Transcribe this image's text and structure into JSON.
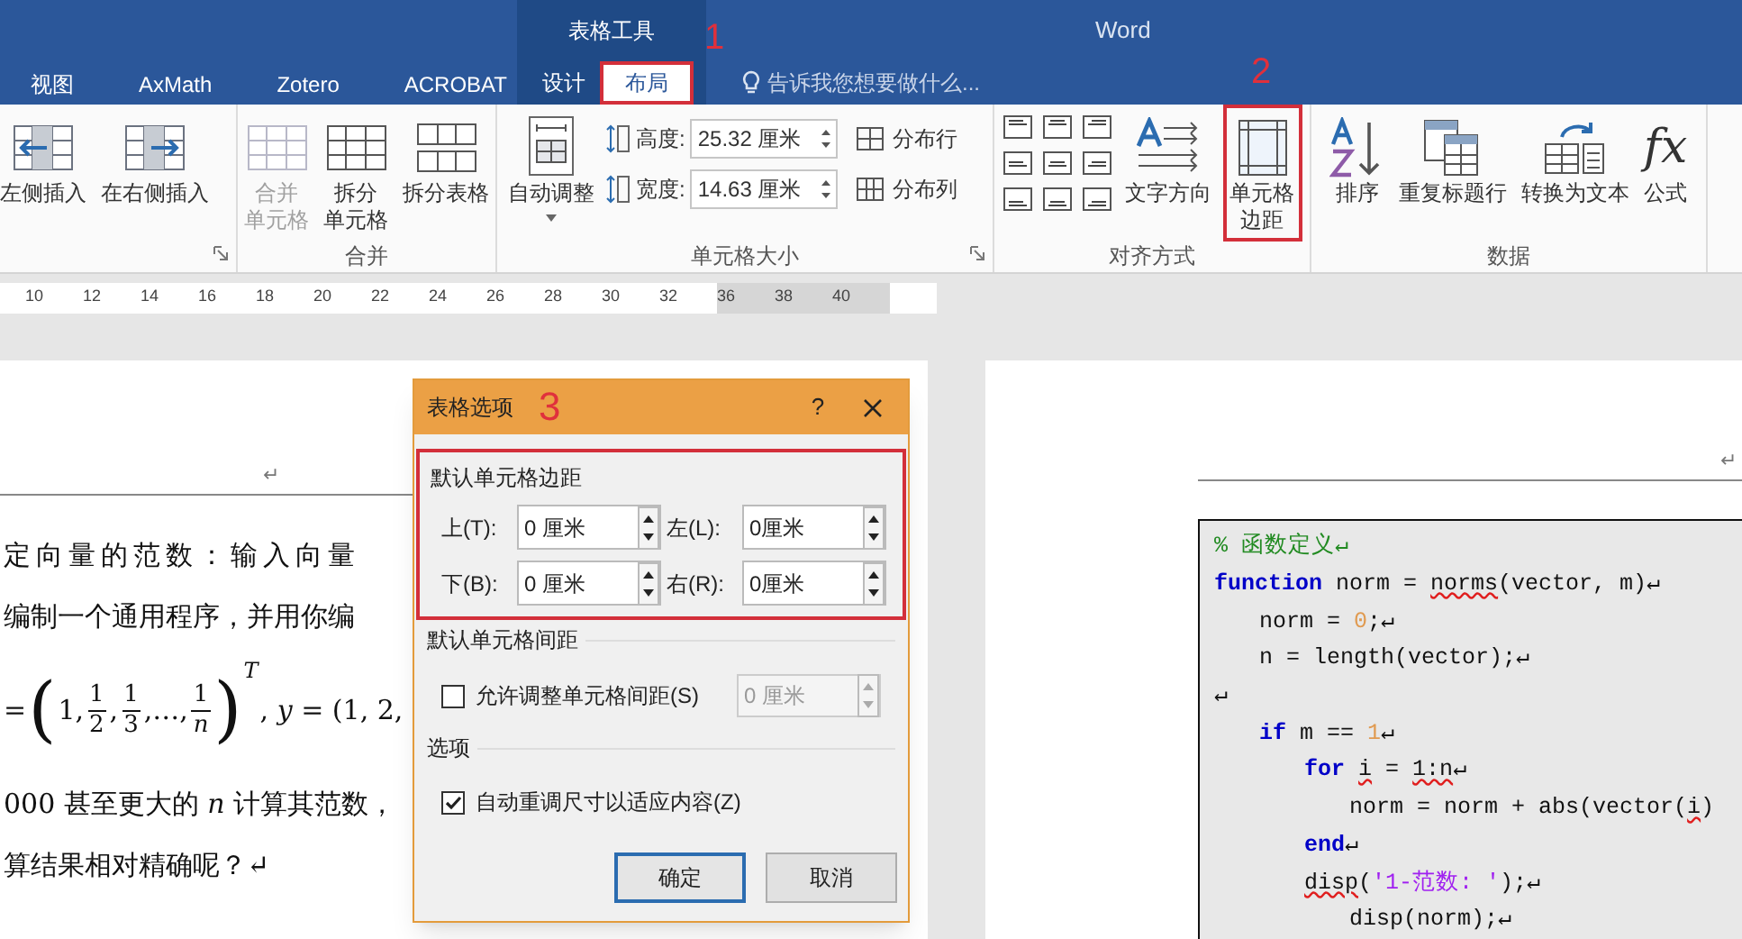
{
  "title_bar": {
    "context_tab": "表格工具",
    "app_name": "Word"
  },
  "tabs": [
    {
      "label": "视图",
      "selected": false,
      "contextual": false
    },
    {
      "label": "AxMath",
      "selected": false,
      "contextual": false
    },
    {
      "label": "Zotero",
      "selected": false,
      "contextual": false
    },
    {
      "label": "ACROBAT",
      "selected": false,
      "contextual": false
    },
    {
      "label": "设计",
      "selected": false,
      "contextual": true
    },
    {
      "label": "布局",
      "selected": true,
      "contextual": true,
      "highlighted": true,
      "annotation": "1"
    }
  ],
  "tell_me": {
    "placeholder": "告诉我您想要做什么..."
  },
  "ribbon": {
    "rows_columns": {
      "buttons": [
        {
          "kind": "insertleft",
          "lines": [
            "左侧插入"
          ]
        },
        {
          "kind": "insertright",
          "lines": [
            "在右侧插入"
          ]
        }
      ]
    },
    "merge": {
      "label": "合并",
      "buttons": [
        {
          "kind": "merge",
          "lines": [
            "合并",
            "单元格"
          ],
          "disabled": true
        },
        {
          "kind": "split",
          "lines": [
            "拆分",
            "单元格"
          ],
          "disabled": false
        },
        {
          "kind": "splittable",
          "lines": [
            "拆分表格"
          ],
          "disabled": false
        }
      ]
    },
    "cell_size": {
      "label": "单元格大小",
      "autofit": {
        "kind": "autofit",
        "lines": [
          "自动调整"
        ]
      },
      "height": {
        "label": "高度:",
        "value": "25.32 厘米"
      },
      "width": {
        "label": "宽度:",
        "value": "14.63 厘米"
      },
      "distribute": [
        {
          "kind": "rows",
          "label": "分布行"
        },
        {
          "kind": "cols",
          "label": "分布列"
        }
      ]
    },
    "alignment": {
      "label": "对齐方式",
      "buttons": [
        {
          "kind": "textdirection",
          "lines": [
            "文字方向"
          ],
          "highlighted": false
        },
        {
          "kind": "margins",
          "lines": [
            "单元格",
            "边距"
          ],
          "highlighted": true,
          "annotation": "2"
        }
      ]
    },
    "data": {
      "label": "数据",
      "buttons": [
        {
          "kind": "sort",
          "lines": [
            "排序"
          ]
        },
        {
          "kind": "repeatheader",
          "lines": [
            "重复标题行"
          ]
        },
        {
          "kind": "totext",
          "lines": [
            "转换为文本"
          ]
        },
        {
          "kind": "formula",
          "icon_text": "fx",
          "lines": [
            "公式"
          ]
        }
      ]
    }
  },
  "ruler": {
    "ticks": [
      {
        "label": "10",
        "margin": false
      },
      {
        "label": "12",
        "margin": false
      },
      {
        "label": "14",
        "margin": false
      },
      {
        "label": "16",
        "margin": false
      },
      {
        "label": "18",
        "margin": false
      },
      {
        "label": "20",
        "margin": false
      },
      {
        "label": "22",
        "margin": false
      },
      {
        "label": "24",
        "margin": false
      },
      {
        "label": "26",
        "margin": false
      },
      {
        "label": "28",
        "margin": false
      },
      {
        "label": "30",
        "margin": false
      },
      {
        "label": "32",
        "margin": false
      },
      {
        "label": "36",
        "margin": true
      },
      {
        "label": "38",
        "margin": true
      },
      {
        "label": "40",
        "margin": true
      }
    ]
  },
  "left_page": {
    "header_mark": "↵",
    "paragraphs": [
      {
        "kind": "text",
        "text": "定向量的范数：输入向量"
      },
      {
        "kind": "text",
        "text": "编制一个通用程序，并用你编"
      },
      {
        "kind": "formula",
        "tokens": [
          {
            "kind": "text",
            "text": "="
          },
          {
            "kind": "paren",
            "text": "("
          },
          {
            "kind": "text",
            "text": "1,"
          },
          {
            "kind": "frac",
            "num": "1",
            "den": "2"
          },
          {
            "kind": "text",
            "text": ","
          },
          {
            "kind": "frac",
            "num": "1",
            "den": "3"
          },
          {
            "kind": "text",
            "text": ",…,"
          },
          {
            "kind": "frac",
            "num": "1",
            "den": "*n*"
          },
          {
            "kind": "paren",
            "text": ")"
          },
          {
            "kind": "sup",
            "text": "*T*"
          },
          {
            "kind": "text",
            "text": ", *y* = (1, 2,"
          }
        ]
      },
      {
        "kind": "text",
        "text": "000 甚至更大的 *n* 计算其范数，"
      },
      {
        "kind": "text",
        "text": "算结果相对精确呢？↵"
      }
    ]
  },
  "right_page": {
    "header_mark": "↵",
    "code_lines": [
      {
        "kind": "code",
        "tokens": [
          {
            "kind": "comment",
            "text": "% 函数定义↵"
          }
        ]
      },
      {
        "kind": "code",
        "tokens": [
          {
            "kind": "keyword",
            "text": "function"
          },
          {
            "kind": "plain",
            "text": " norm = "
          },
          {
            "kind": "error",
            "text": "norms"
          },
          {
            "kind": "plain",
            "text": "(vector, m)↵"
          }
        ],
        "children": [
          {
            "kind": "code",
            "tokens": [
              {
                "kind": "plain",
                "text": "norm = "
              },
              {
                "kind": "number",
                "text": "0"
              },
              {
                "kind": "plain",
                "text": ";↵"
              }
            ]
          },
          {
            "kind": "code",
            "tokens": [
              {
                "kind": "plain",
                "text": "n = length(vector);↵"
              }
            ]
          },
          {
            "kind": "blank",
            "tokens": [
              {
                "kind": "plain",
                "text": "↵"
              }
            ]
          },
          {
            "kind": "code",
            "tokens": [
              {
                "kind": "keyword",
                "text": "if"
              },
              {
                "kind": "plain",
                "text": " m == "
              },
              {
                "kind": "number",
                "text": "1"
              },
              {
                "kind": "plain",
                "text": "↵"
              }
            ],
            "children": [
              {
                "kind": "code",
                "tokens": [
                  {
                    "kind": "keyword",
                    "text": "for "
                  },
                  {
                    "kind": "error",
                    "text": "i"
                  },
                  {
                    "kind": "plain",
                    "text": " = "
                  },
                  {
                    "kind": "error",
                    "text": "1:n"
                  },
                  {
                    "kind": "plain",
                    "text": "↵"
                  }
                ],
                "children": [
                  {
                    "kind": "code",
                    "tokens": [
                      {
                        "kind": "plain",
                        "text": "norm = norm + abs(vector("
                      },
                      {
                        "kind": "error",
                        "text": "i"
                      },
                      {
                        "kind": "plain",
                        "text": ")"
                      }
                    ]
                  }
                ]
              },
              {
                "kind": "code",
                "tokens": [
                  {
                    "kind": "keyword",
                    "text": "end"
                  },
                  {
                    "kind": "plain",
                    "text": "↵"
                  }
                ]
              },
              {
                "kind": "code",
                "tokens": [
                  {
                    "kind": "error",
                    "text": "disp"
                  },
                  {
                    "kind": "plain",
                    "text": "("
                  },
                  {
                    "kind": "string",
                    "text": "'1-范数: '"
                  },
                  {
                    "kind": "plain",
                    "text": ");↵"
                  }
                ],
                "children": [
                  {
                    "kind": "code",
                    "tokens": [
                      {
                        "kind": "plain",
                        "text": "disp(norm);↵"
                      }
                    ]
                  }
                ]
              }
            ]
          }
        ]
      }
    ]
  },
  "dialog": {
    "title": "表格选项",
    "annotation": "3",
    "help": "?",
    "margins": {
      "label": "默认单元格边距",
      "highlighted": true,
      "fields": [
        {
          "label": "上(T):",
          "value": "0 厘米"
        },
        {
          "label": "左(L):",
          "value": "0厘米"
        },
        {
          "label": "下(B):",
          "value": "0 厘米"
        },
        {
          "label": "右(R):",
          "value": "0厘米"
        }
      ]
    },
    "spacing": {
      "label": "默认单元格间距",
      "checkbox": {
        "label": "允许调整单元格间距(S)",
        "checked": false
      },
      "field": {
        "value": "0 厘米",
        "disabled": true
      }
    },
    "options": {
      "label": "选项",
      "checkbox": {
        "label": "自动重调尺寸以适应内容(Z)",
        "checked": true
      }
    },
    "buttons": [
      {
        "label": "确定",
        "default": true
      },
      {
        "label": "取消",
        "default": false
      }
    ]
  }
}
